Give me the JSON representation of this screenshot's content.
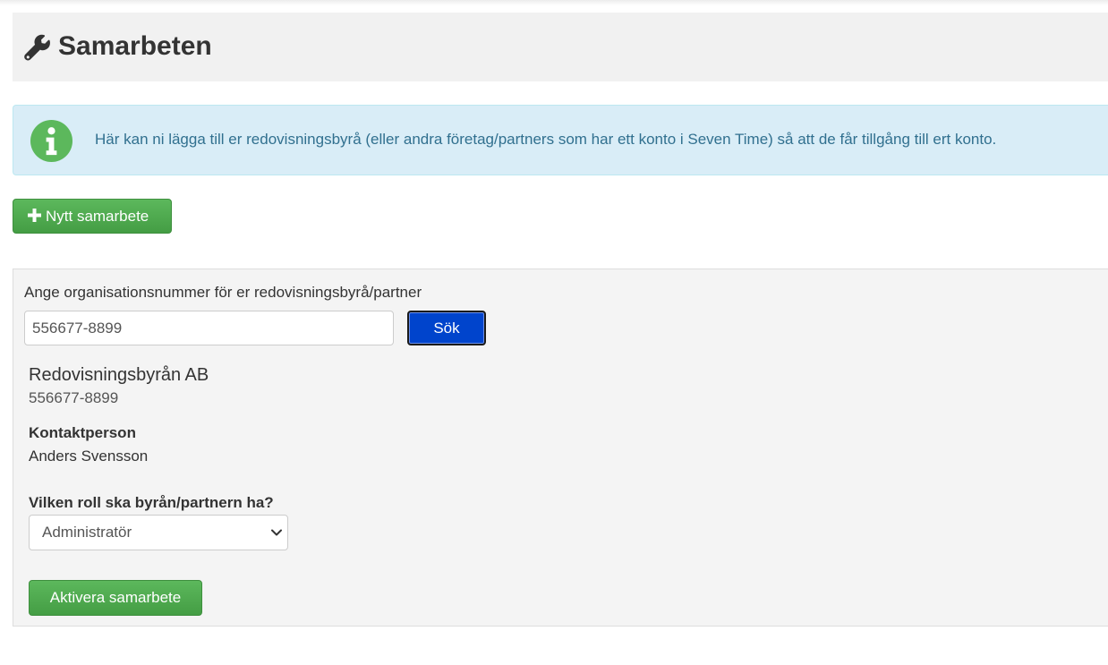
{
  "header": {
    "title": "Samarbeten",
    "icon": "wrench-icon"
  },
  "info": {
    "icon": "info-icon",
    "text": "Här kan ni lägga till er redovisningsbyrå (eller andra företag/partners som har ett konto i Seven Time) så att de får tillgång till ert konto."
  },
  "actions": {
    "new_label": "Nytt samarbete",
    "new_icon": "plus-icon"
  },
  "search": {
    "label": "Ange organisationsnummer för er redovisningsbyrå/partner",
    "value": "556677-8899",
    "button_label": "Sök"
  },
  "result": {
    "company_name": "Redovisningsbyrån AB",
    "org_number": "556677-8899",
    "contact_label": "Kontaktperson",
    "contact_name": "Anders Svensson"
  },
  "role": {
    "label": "Vilken roll ska byrån/partnern ha?",
    "selected": "Administratör"
  },
  "submit": {
    "label": "Aktivera samarbete"
  },
  "colors": {
    "success": "#5cb85c",
    "info_bg": "#d9edf7",
    "info_text": "#31708f",
    "primary_focus": "#0044cc"
  }
}
